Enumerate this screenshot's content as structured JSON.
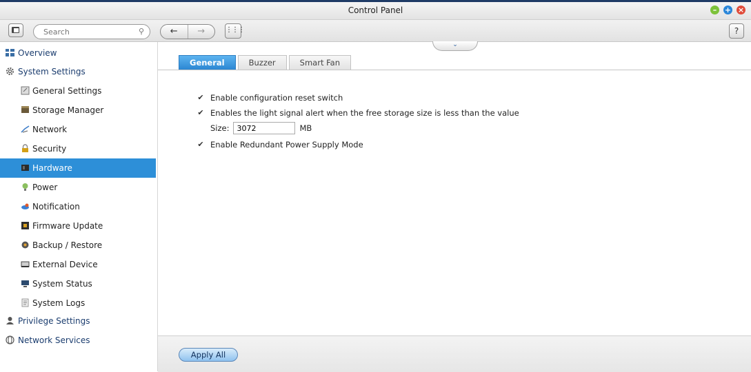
{
  "window": {
    "title": "Control Panel"
  },
  "toolbar": {
    "search_placeholder": "Search",
    "back_glyph": "←",
    "forward_glyph": "→",
    "apps_glyph": "⋮⋮⋮",
    "help_label": "?"
  },
  "sidebar": {
    "overview": "Overview",
    "system_settings": "System Settings",
    "items": [
      "General Settings",
      "Storage Manager",
      "Network",
      "Security",
      "Hardware",
      "Power",
      "Notification",
      "Firmware Update",
      "Backup / Restore",
      "External Device",
      "System Status",
      "System Logs"
    ],
    "privilege_settings": "Privilege Settings",
    "network_services": "Network Services",
    "active_item": "Hardware"
  },
  "tabs": [
    "General",
    "Buzzer",
    "Smart Fan"
  ],
  "active_tab": "General",
  "settings": {
    "reset_switch": "Enable configuration reset switch",
    "light_alert": "Enables the light signal alert when the free storage size is less than the value",
    "size_label": "Size:",
    "size_value": "3072",
    "size_unit": "MB",
    "redundant_power": "Enable Redundant Power Supply Mode"
  },
  "checkbox_states": {
    "reset_switch": true,
    "light_alert": true,
    "redundant_power": true
  },
  "footer": {
    "apply_label": "Apply All"
  },
  "colors": {
    "accent": "#2d8fd8",
    "title_bar": "#1f3b66"
  }
}
